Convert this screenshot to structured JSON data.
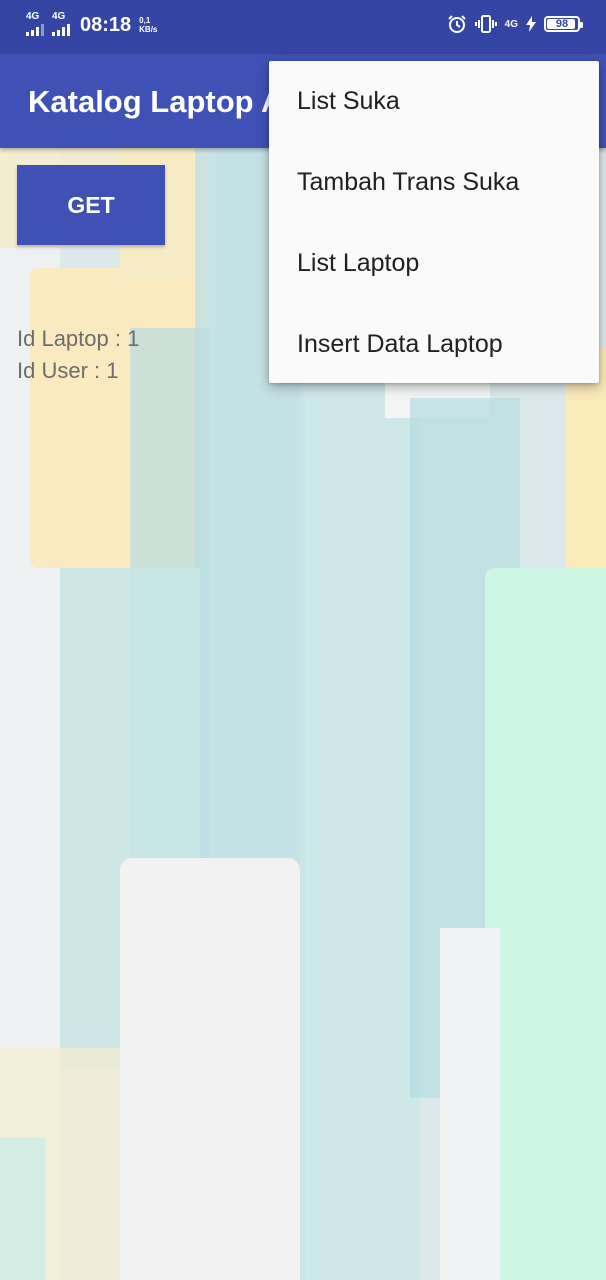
{
  "status_bar": {
    "sim1": "4G",
    "sim2": "4G",
    "time": "08:18",
    "speed_value": "0,1",
    "speed_unit": "KB/s",
    "net_type": "4G",
    "battery_level": "98",
    "icons": [
      "alarm-icon",
      "vibrate-icon",
      "signal-4g-icon",
      "charging-icon",
      "battery-icon"
    ]
  },
  "toolbar": {
    "title": "Katalog Laptop A"
  },
  "main": {
    "get_button": "GET",
    "id_laptop": "Id Laptop :  1",
    "id_user": "Id User :  1"
  },
  "menu": {
    "items": [
      "List Suka",
      "Tambah Trans Suka",
      "List Laptop",
      "Insert Data Laptop"
    ]
  },
  "colors": {
    "status_bar": "#3545a3",
    "toolbar": "#3f51b5",
    "button": "#3f51b5",
    "menu_bg": "#fafafa"
  }
}
